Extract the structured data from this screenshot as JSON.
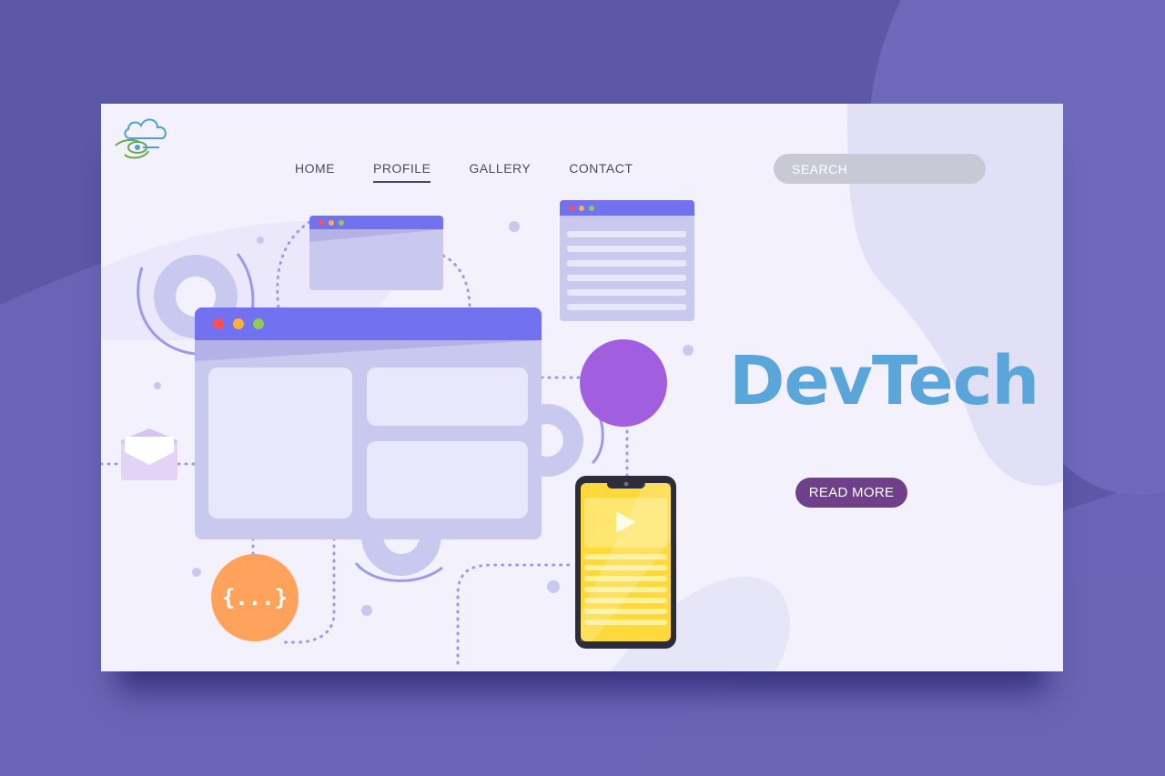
{
  "nav": {
    "items": [
      {
        "label": "HOME",
        "active": false
      },
      {
        "label": "PROFILE",
        "active": true
      },
      {
        "label": "GALLERY",
        "active": false
      },
      {
        "label": "CONTACT",
        "active": false
      }
    ]
  },
  "search": {
    "placeholder": "SEARCH"
  },
  "hero": {
    "headline": "DevTech",
    "cta_label": "READ MORE"
  },
  "illustration": {
    "code_badge": "{...}"
  },
  "colors": {
    "background": "#5c57a6",
    "card": "#f2f1fc",
    "window_header": "#7272f0",
    "window_body": "#c9c8ef",
    "headline": "#5aa5da",
    "cta": "#6f3f8a",
    "code_badge": "#ffa35c",
    "circle": "#a15ede",
    "phone_screen": "#ffd83b"
  }
}
